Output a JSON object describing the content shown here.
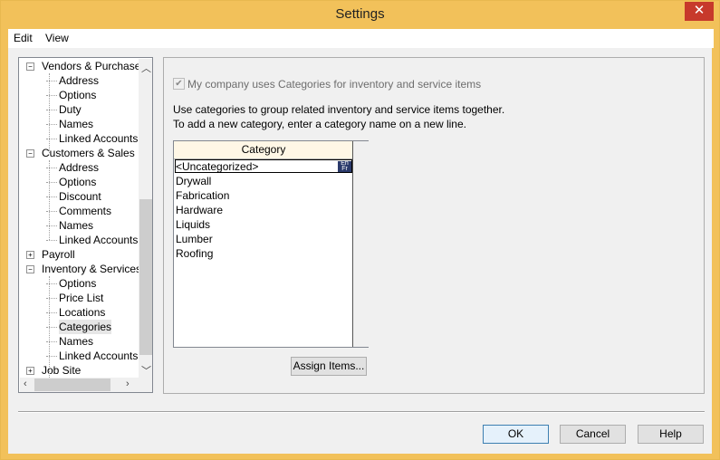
{
  "window": {
    "title": "Settings",
    "close_glyph": "✕"
  },
  "menu": {
    "items": [
      {
        "label": "Edit"
      },
      {
        "label": "View"
      }
    ]
  },
  "tree": {
    "items": [
      {
        "label": "Vendors & Purchases",
        "level": 0,
        "expander": "−"
      },
      {
        "label": "Address",
        "level": 1
      },
      {
        "label": "Options",
        "level": 1
      },
      {
        "label": "Duty",
        "level": 1
      },
      {
        "label": "Names",
        "level": 1
      },
      {
        "label": "Linked Accounts",
        "level": 1
      },
      {
        "label": "Customers & Sales",
        "level": 0,
        "expander": "−"
      },
      {
        "label": "Address",
        "level": 1
      },
      {
        "label": "Options",
        "level": 1
      },
      {
        "label": "Discount",
        "level": 1
      },
      {
        "label": "Comments",
        "level": 1
      },
      {
        "label": "Names",
        "level": 1
      },
      {
        "label": "Linked Accounts",
        "level": 1
      },
      {
        "label": "Payroll",
        "level": 0,
        "expander": "+"
      },
      {
        "label": "Inventory & Services",
        "level": 0,
        "expander": "−"
      },
      {
        "label": "Options",
        "level": 1
      },
      {
        "label": "Price List",
        "level": 1
      },
      {
        "label": "Locations",
        "level": 1
      },
      {
        "label": "Categories",
        "level": 1,
        "selected": true
      },
      {
        "label": "Names",
        "level": 1
      },
      {
        "label": "Linked Accounts",
        "level": 1
      },
      {
        "label": "Job Site",
        "level": 0,
        "expander": "+"
      }
    ]
  },
  "panel": {
    "checkbox_label": "My company uses Categories for inventory and service items",
    "checkbox_checked": true,
    "info_line1": "Use categories to group related inventory and service items together.",
    "info_line2": "To add a new category, enter a category name on a new line.",
    "grid": {
      "header": "Category",
      "rows": [
        "<Uncategorized>",
        "Drywall",
        "Fabrication",
        "Hardware",
        "Liquids",
        "Lumber",
        "Roofing"
      ],
      "ime_badge": "En Fr"
    },
    "assign_button": "Assign Items..."
  },
  "buttons": {
    "ok": "OK",
    "cancel": "Cancel",
    "help": "Help"
  }
}
